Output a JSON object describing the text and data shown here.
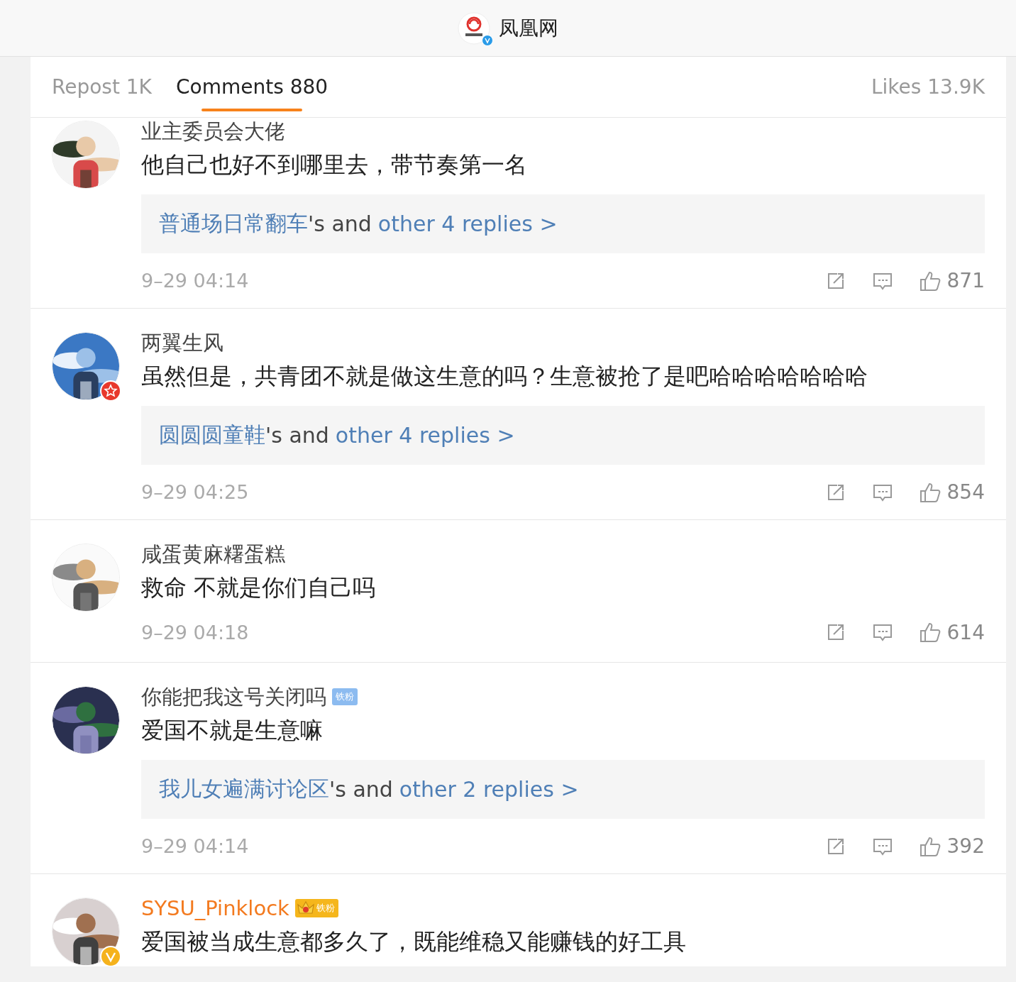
{
  "header": {
    "account_name": "凤凰网",
    "verified": true
  },
  "tabs": [
    {
      "label": "Repost 1K",
      "selected": false
    },
    {
      "label": "Comments 880",
      "selected": true
    },
    {
      "label": "Likes 13.9K",
      "selected": false
    }
  ],
  "comments": [
    {
      "name": "业主委员会大佬",
      "vip": false,
      "text": "他自己也好不到哪里去，带节奏第一名",
      "replies": {
        "replier": "普通场日常翻车",
        "joiner": "'s and",
        "link": "other 4 replies >"
      },
      "time": "9–29 04:14",
      "likes": "871"
    },
    {
      "name": "两翼生风",
      "vip": false,
      "avatar_badge": {
        "kind": "red_star"
      },
      "text": "虽然但是，共青团不就是做这生意的吗？生意被抢了是吧哈哈哈哈哈哈哈",
      "replies": {
        "replier": "圆圆圆童鞋",
        "joiner": "'s and",
        "link": "other 4 replies >"
      },
      "time": "9–29 04:25",
      "likes": "854"
    },
    {
      "name": "咸蛋黄麻糬蛋糕",
      "vip": false,
      "text": "救命 不就是你们自己吗",
      "time": "9–29 04:18",
      "likes": "614"
    },
    {
      "name": "你能把我这号关闭吗",
      "vip": false,
      "badges": [
        {
          "kind": "fan",
          "label": "铁粉"
        }
      ],
      "text": "爱国不就是生意嘛",
      "replies": {
        "replier": "我儿女遍满讨论区",
        "joiner": "'s and",
        "link": "other 2 replies >"
      },
      "time": "9–29 04:14",
      "likes": "392"
    },
    {
      "name": "SYSU_Pinklock",
      "vip": true,
      "avatar_badge": {
        "kind": "gold_v"
      },
      "badges": [
        {
          "kind": "crown_fan",
          "label": "铁粉"
        }
      ],
      "text": "爱国被当成生意都多久了，既能维稳又能赚钱的好工具"
    }
  ]
}
